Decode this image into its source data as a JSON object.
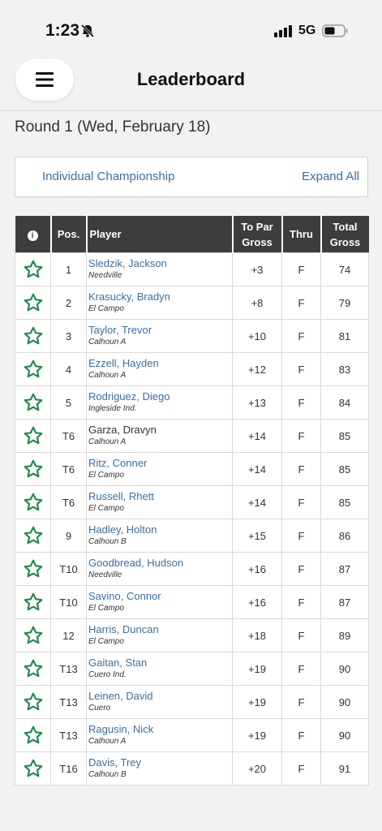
{
  "status_bar": {
    "time": "1:23",
    "network": "5G",
    "bell_icon": "bell-slash-icon",
    "signal_icon": "signal-bars-icon",
    "battery_icon": "battery-icon"
  },
  "header": {
    "title": "Leaderboard",
    "menu_icon": "hamburger-icon"
  },
  "round": "Round 1 (Wed, February 18)",
  "championship": {
    "label": "Individual Championship",
    "expand_label": "Expand All"
  },
  "table": {
    "columns": {
      "info": "i",
      "pos": "Pos.",
      "player": "Player",
      "to_par_1": "To Par",
      "to_par_2": "Gross",
      "thru": "Thru",
      "total_1": "Total",
      "total_2": "Gross"
    },
    "rows": [
      {
        "pos": "1",
        "name": "Sledzik, Jackson",
        "school": "Needville",
        "to_par": "+3",
        "thru": "F",
        "total": "74"
      },
      {
        "pos": "2",
        "name": "Krasucky, Bradyn",
        "school": "El Campo",
        "to_par": "+8",
        "thru": "F",
        "total": "79"
      },
      {
        "pos": "3",
        "name": "Taylor, Trevor",
        "school": "Calhoun A",
        "to_par": "+10",
        "thru": "F",
        "total": "81"
      },
      {
        "pos": "4",
        "name": "Ezzell, Hayden",
        "school": "Calhoun A",
        "to_par": "+12",
        "thru": "F",
        "total": "83"
      },
      {
        "pos": "5",
        "name": "Rodriguez, Diego",
        "school": "Ingleside Ind.",
        "to_par": "+13",
        "thru": "F",
        "total": "84"
      },
      {
        "pos": "T6",
        "name": "Garza, Dravyn",
        "school": "Calhoun A",
        "to_par": "+14",
        "thru": "F",
        "total": "85"
      },
      {
        "pos": "T6",
        "name": "Ritz, Conner",
        "school": "El Campo",
        "to_par": "+14",
        "thru": "F",
        "total": "85"
      },
      {
        "pos": "T6",
        "name": "Russell, Rhett",
        "school": "El Campo",
        "to_par": "+14",
        "thru": "F",
        "total": "85"
      },
      {
        "pos": "9",
        "name": "Hadley, Holton",
        "school": "Calhoun B",
        "to_par": "+15",
        "thru": "F",
        "total": "86"
      },
      {
        "pos": "T10",
        "name": "Goodbread, Hudson",
        "school": "Needville",
        "to_par": "+16",
        "thru": "F",
        "total": "87"
      },
      {
        "pos": "T10",
        "name": "Savino, Connor",
        "school": "El Campo",
        "to_par": "+16",
        "thru": "F",
        "total": "87"
      },
      {
        "pos": "12",
        "name": "Harris, Duncan",
        "school": "El Campo",
        "to_par": "+18",
        "thru": "F",
        "total": "89"
      },
      {
        "pos": "T13",
        "name": "Gaitan, Stan",
        "school": "Cuero Ind.",
        "to_par": "+19",
        "thru": "F",
        "total": "90"
      },
      {
        "pos": "T13",
        "name": "Leinen, David",
        "school": "Cuero",
        "to_par": "+19",
        "thru": "F",
        "total": "90"
      },
      {
        "pos": "T13",
        "name": "Ragusin, Nick",
        "school": "Calhoun A",
        "to_par": "+19",
        "thru": "F",
        "total": "90"
      },
      {
        "pos": "T16",
        "name": "Davis, Trey",
        "school": "Calhoun B",
        "to_par": "+20",
        "thru": "F",
        "total": "91"
      }
    ]
  },
  "colors": {
    "header_bg": "#3d3d40",
    "link": "#3a6ea5",
    "star": "#1f8a4c",
    "page_bg": "#f2f2f2"
  }
}
